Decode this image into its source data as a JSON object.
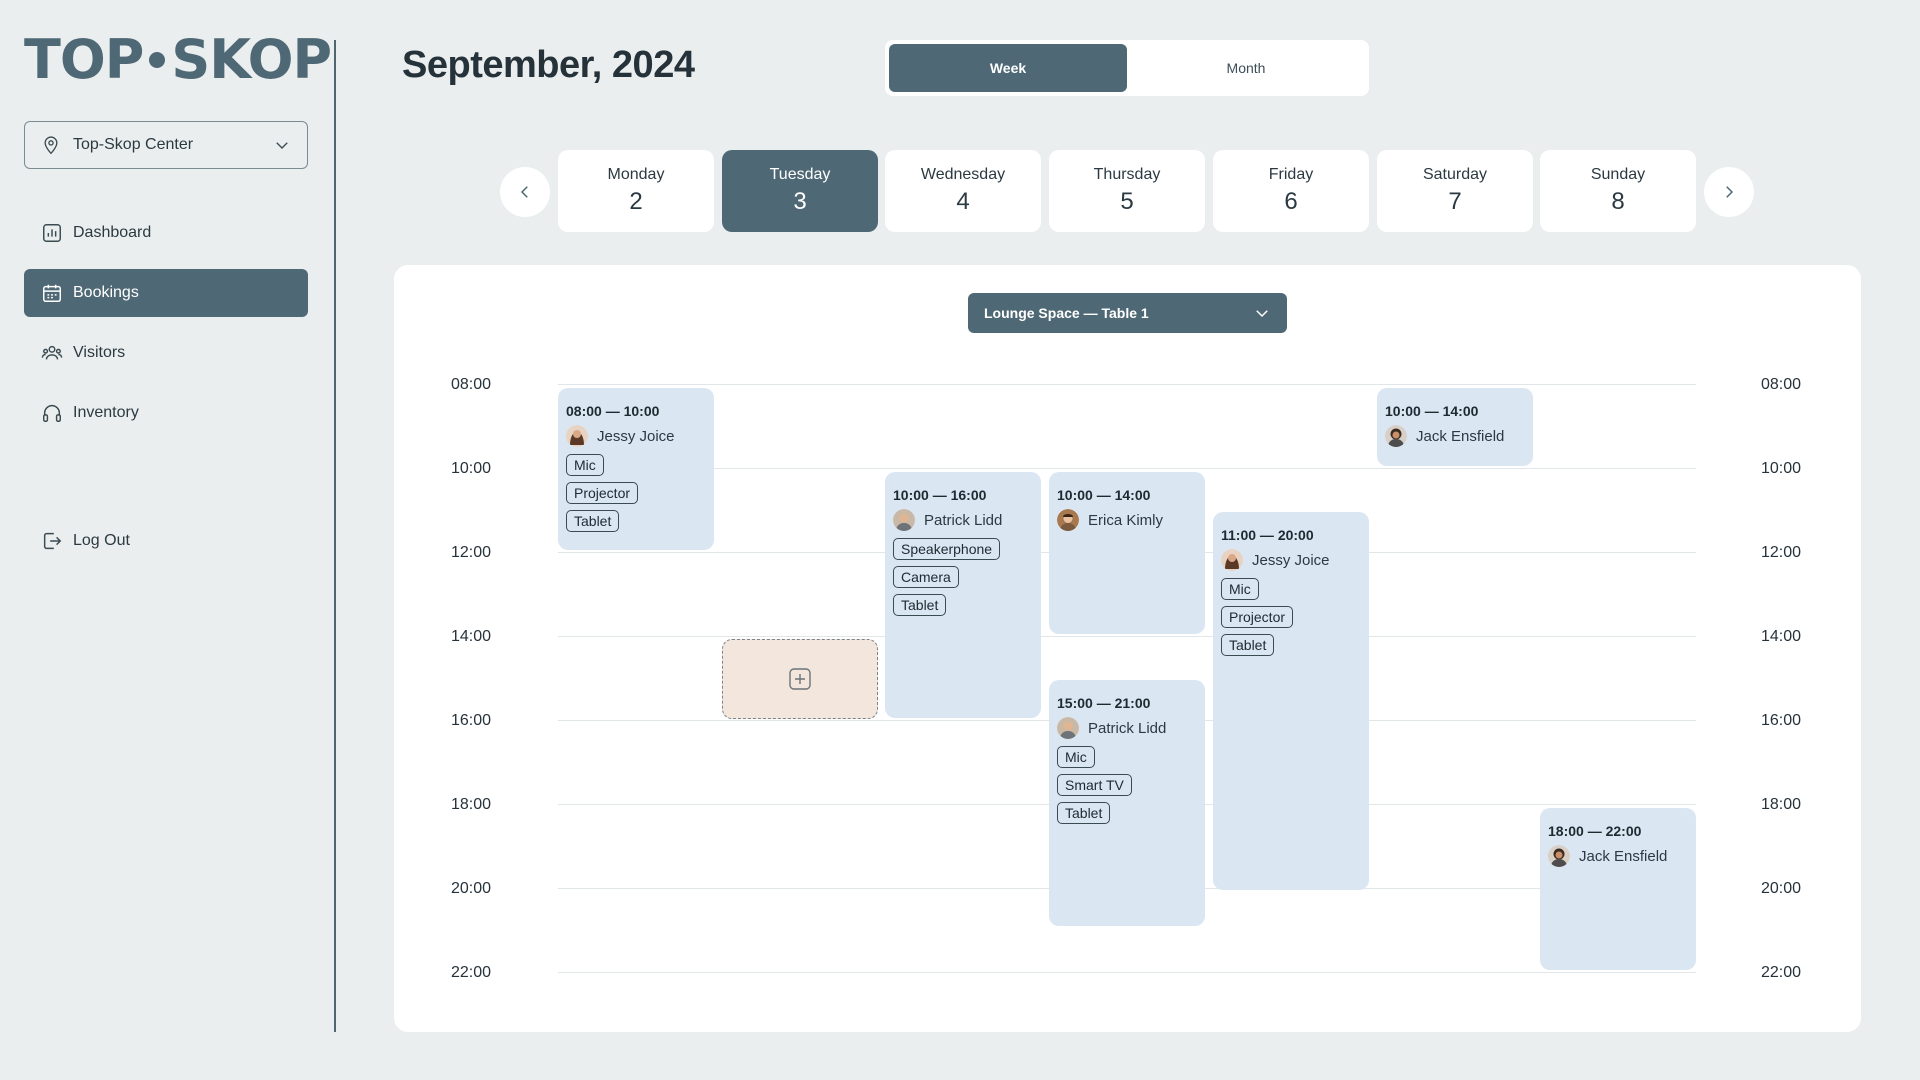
{
  "brand": {
    "left": "TOP",
    "right": "SKOP"
  },
  "sidebar": {
    "location": "Top-Skop Center",
    "nav": [
      {
        "label": "Dashboard",
        "icon": "chart-icon"
      },
      {
        "label": "Bookings",
        "icon": "calendar-icon",
        "active": true
      },
      {
        "label": "Visitors",
        "icon": "users-icon"
      },
      {
        "label": "Inventory",
        "icon": "headphones-icon"
      }
    ],
    "logout": "Log Out"
  },
  "header": {
    "title": "September, 2024",
    "view_toggle": {
      "week": "Week",
      "month": "Month",
      "selected": "Week"
    }
  },
  "days": [
    {
      "name": "Monday",
      "num": "2"
    },
    {
      "name": "Tuesday",
      "num": "3",
      "active": true
    },
    {
      "name": "Wednesday",
      "num": "4"
    },
    {
      "name": "Thursday",
      "num": "5"
    },
    {
      "name": "Friday",
      "num": "6"
    },
    {
      "name": "Saturday",
      "num": "7"
    },
    {
      "name": "Sunday",
      "num": "8"
    }
  ],
  "space_select": "Lounge Space — Table 1",
  "times": [
    "08:00",
    "10:00",
    "12:00",
    "14:00",
    "16:00",
    "18:00",
    "20:00",
    "22:00"
  ],
  "bookings": [
    {
      "time": "08:00 — 10:00",
      "person": "Jessy Joice",
      "tags": [
        "Mic",
        "Projector",
        "Tablet"
      ]
    },
    {
      "time": "10:00 — 16:00",
      "person": "Patrick Lidd",
      "tags": [
        "Speakerphone",
        "Camera",
        "Tablet"
      ]
    },
    {
      "time": "10:00 — 14:00",
      "person": "Erica Kimly",
      "tags": []
    },
    {
      "time": "15:00 — 21:00",
      "person": "Patrick Lidd",
      "tags": [
        "Mic",
        "Smart TV",
        "Tablet"
      ]
    },
    {
      "time": "11:00 — 20:00",
      "person": "Jessy Joice",
      "tags": [
        "Mic",
        "Projector",
        "Tablet"
      ]
    },
    {
      "time": "10:00 — 14:00",
      "person": "Jack Ensfield",
      "tags": []
    },
    {
      "time": "18:00 — 22:00",
      "person": "Jack Ensfield",
      "tags": []
    }
  ],
  "colors": {
    "accent": "#4f6875",
    "event_bg": "#dbe6f3",
    "new_slot_bg": "#f3e6dc",
    "page_bg": "#ebeeef"
  }
}
